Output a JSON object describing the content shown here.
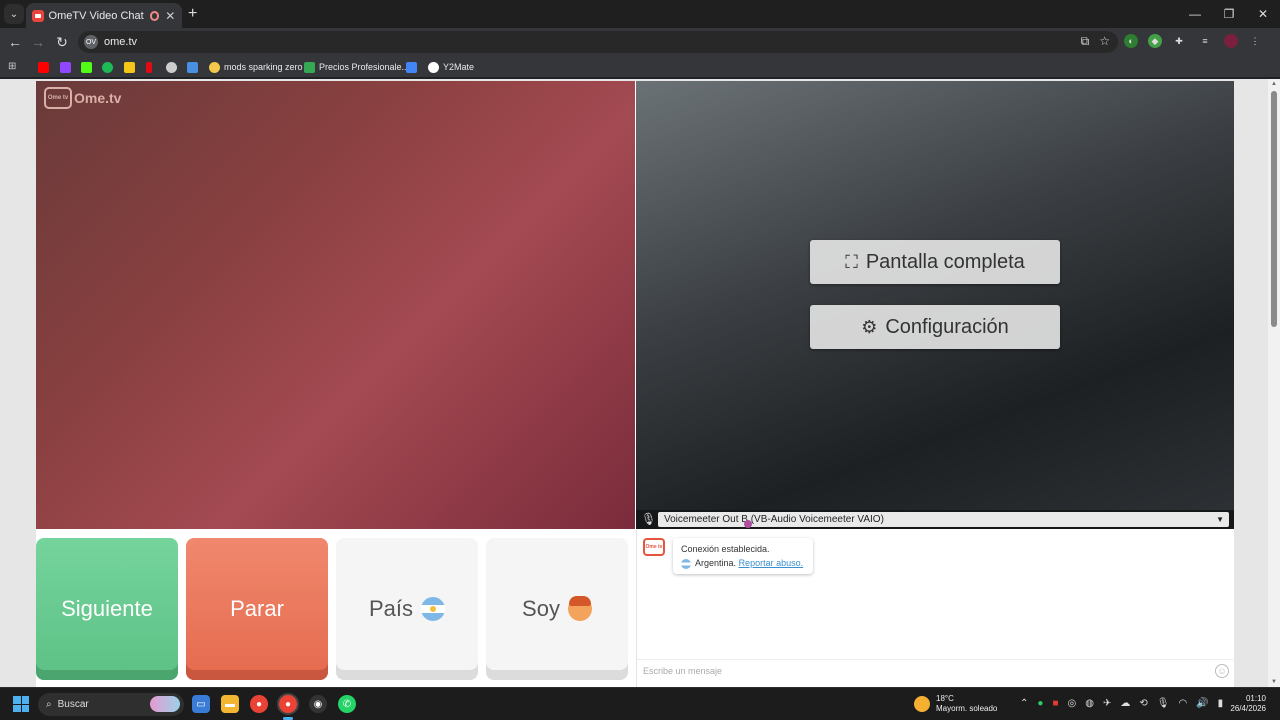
{
  "browser": {
    "tab_title": "OmeTV Video Chat — Ome",
    "url": "ome.tv",
    "site_icon_label": "OV",
    "bookmarks": [
      {
        "label": "",
        "color": "#ff0000"
      },
      {
        "label": "",
        "color": "#9146ff"
      },
      {
        "label": "",
        "color": "#53fc18"
      },
      {
        "label": "",
        "color": "#1db954"
      },
      {
        "label": "",
        "color": "#f5c518"
      },
      {
        "label": "",
        "color": "#e50914"
      },
      {
        "label": "",
        "color": "#cccccc"
      },
      {
        "label": "",
        "color": "#4a90e2"
      },
      {
        "label": "mods sparking zero",
        "color": "#f2c94c"
      },
      {
        "label": "Precios Profesionale...",
        "color": "#34a853"
      },
      {
        "label": "",
        "color": "#4285f4"
      },
      {
        "label": "Y2Mate",
        "color": "#ffffff"
      }
    ]
  },
  "app": {
    "logo_text": "Ome.tv",
    "logo_badge": "Ome tv",
    "overlay": {
      "fullscreen_label": "Pantalla completa",
      "settings_label": "Configuración"
    },
    "mic_device": "Voicemeeter Out B (VB-Audio Voicemeeter VAIO)",
    "buttons": {
      "next": "Siguiente",
      "stop": "Parar",
      "country": "País",
      "gender": "Soy"
    },
    "chat": {
      "status": "Conexión establecida.",
      "country": "Argentina.",
      "report": "Reportar abuso.",
      "input_placeholder": "Escribe un mensaje"
    }
  },
  "taskbar": {
    "search_label": "Buscar",
    "weather_temp": "18°C",
    "weather_desc": "Mayorm. soleado",
    "time": "01:10",
    "date": "26/4/2026"
  }
}
